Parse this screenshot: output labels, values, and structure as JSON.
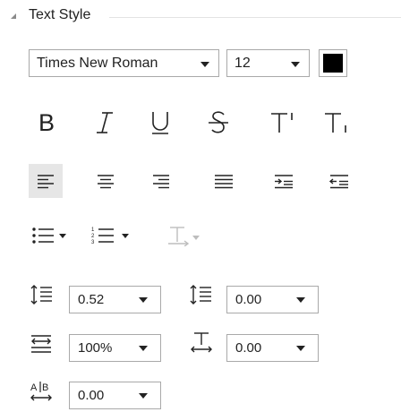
{
  "section": {
    "title": "Text Style",
    "expanded": true
  },
  "font": {
    "family": "Times New Roman",
    "size": "12",
    "color": "#000000"
  },
  "format_buttons": [
    {
      "name": "bold",
      "label": "B"
    },
    {
      "name": "italic",
      "label": "I"
    },
    {
      "name": "underline",
      "label": "U"
    },
    {
      "name": "strikethrough",
      "label": "S"
    },
    {
      "name": "superscript",
      "label": "T"
    },
    {
      "name": "subscript",
      "label": "T"
    }
  ],
  "alignment": {
    "selected": "align-left",
    "options": [
      "align-left",
      "align-center",
      "align-right",
      "justify",
      "increase-indent",
      "decrease-indent"
    ]
  },
  "lists": {
    "bullet_icon": "bullet-list-icon",
    "numbered_icon": "numbered-list-icon",
    "text_direction_enabled": false
  },
  "spacing": {
    "line_spacing": "0.52",
    "paragraph_spacing": "0.00",
    "character_width": "100%",
    "character_spacing": "0.00",
    "kerning": "0.00"
  }
}
